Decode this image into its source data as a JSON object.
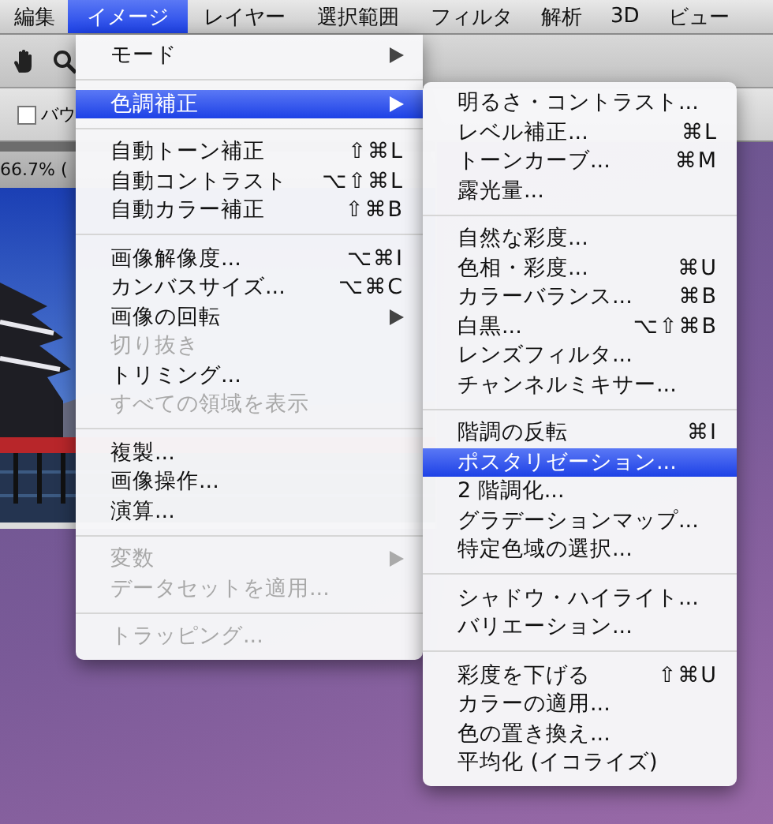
{
  "menu_bar": [
    {
      "label": "編集",
      "selected": false
    },
    {
      "label": "イメージ",
      "selected": true
    },
    {
      "label": "レイヤー",
      "selected": false
    },
    {
      "label": "選択範囲",
      "selected": false
    },
    {
      "label": "フィルタ",
      "selected": false
    },
    {
      "label": "解析",
      "selected": false
    },
    {
      "label": "3D",
      "selected": false
    },
    {
      "label": "ビュー",
      "selected": false
    }
  ],
  "options_bar": {
    "checkbox": {
      "label": "バウ",
      "checked": false
    }
  },
  "document": {
    "tab_title": "66.7% ("
  },
  "image_menu": {
    "items": [
      {
        "kind": "item",
        "label": "モード",
        "has_submenu": true,
        "disabled": false,
        "selected": false
      },
      {
        "kind": "separator"
      },
      {
        "kind": "item",
        "label": "色調補正",
        "has_submenu": true,
        "disabled": false,
        "selected": true
      },
      {
        "kind": "separator"
      },
      {
        "kind": "item",
        "label": "自動トーン補正",
        "shortcut": "⇧⌘L",
        "has_submenu": false,
        "disabled": false,
        "selected": false
      },
      {
        "kind": "item",
        "label": "自動コントラスト",
        "shortcut": "⌥⇧⌘L",
        "has_submenu": false,
        "disabled": false,
        "selected": false
      },
      {
        "kind": "item",
        "label": "自動カラー補正",
        "shortcut": "⇧⌘B",
        "has_submenu": false,
        "disabled": false,
        "selected": false
      },
      {
        "kind": "separator"
      },
      {
        "kind": "item",
        "label": "画像解像度...",
        "shortcut": "⌥⌘I",
        "has_submenu": false,
        "disabled": false,
        "selected": false
      },
      {
        "kind": "item",
        "label": "カンバスサイズ...",
        "shortcut": "⌥⌘C",
        "has_submenu": false,
        "disabled": false,
        "selected": false
      },
      {
        "kind": "item",
        "label": "画像の回転",
        "has_submenu": true,
        "disabled": false,
        "selected": false
      },
      {
        "kind": "item",
        "label": "切り抜き",
        "has_submenu": false,
        "disabled": true,
        "selected": false
      },
      {
        "kind": "item",
        "label": "トリミング...",
        "has_submenu": false,
        "disabled": false,
        "selected": false
      },
      {
        "kind": "item",
        "label": "すべての領域を表示",
        "has_submenu": false,
        "disabled": true,
        "selected": false
      },
      {
        "kind": "separator"
      },
      {
        "kind": "item",
        "label": "複製...",
        "has_submenu": false,
        "disabled": false,
        "selected": false
      },
      {
        "kind": "item",
        "label": "画像操作...",
        "has_submenu": false,
        "disabled": false,
        "selected": false
      },
      {
        "kind": "item",
        "label": "演算...",
        "has_submenu": false,
        "disabled": false,
        "selected": false
      },
      {
        "kind": "separator"
      },
      {
        "kind": "item",
        "label": "変数",
        "has_submenu": true,
        "disabled": true,
        "selected": false
      },
      {
        "kind": "item",
        "label": "データセットを適用...",
        "has_submenu": false,
        "disabled": true,
        "selected": false
      },
      {
        "kind": "separator"
      },
      {
        "kind": "item",
        "label": "トラッピング...",
        "has_submenu": false,
        "disabled": true,
        "selected": false
      }
    ]
  },
  "adjustments_menu": {
    "items": [
      {
        "kind": "item",
        "label": "明るさ・コントラスト...",
        "has_submenu": false,
        "disabled": false,
        "selected": false
      },
      {
        "kind": "item",
        "label": "レベル補正...",
        "shortcut": "⌘L",
        "has_submenu": false,
        "disabled": false,
        "selected": false
      },
      {
        "kind": "item",
        "label": "トーンカーブ...",
        "shortcut": "⌘M",
        "has_submenu": false,
        "disabled": false,
        "selected": false
      },
      {
        "kind": "item",
        "label": "露光量...",
        "has_submenu": false,
        "disabled": false,
        "selected": false
      },
      {
        "kind": "separator"
      },
      {
        "kind": "item",
        "label": "自然な彩度...",
        "has_submenu": false,
        "disabled": false,
        "selected": false
      },
      {
        "kind": "item",
        "label": "色相・彩度...",
        "shortcut": "⌘U",
        "has_submenu": false,
        "disabled": false,
        "selected": false
      },
      {
        "kind": "item",
        "label": "カラーバランス...",
        "shortcut": "⌘B",
        "has_submenu": false,
        "disabled": false,
        "selected": false
      },
      {
        "kind": "item",
        "label": "白黒...",
        "shortcut": "⌥⇧⌘B",
        "has_submenu": false,
        "disabled": false,
        "selected": false
      },
      {
        "kind": "item",
        "label": "レンズフィルタ...",
        "has_submenu": false,
        "disabled": false,
        "selected": false
      },
      {
        "kind": "item",
        "label": "チャンネルミキサー...",
        "has_submenu": false,
        "disabled": false,
        "selected": false
      },
      {
        "kind": "separator"
      },
      {
        "kind": "item",
        "label": "階調の反転",
        "shortcut": "⌘I",
        "has_submenu": false,
        "disabled": false,
        "selected": false
      },
      {
        "kind": "item",
        "label": "ポスタリゼーション...",
        "has_submenu": false,
        "disabled": false,
        "selected": true
      },
      {
        "kind": "item",
        "label": "2 階調化...",
        "has_submenu": false,
        "disabled": false,
        "selected": false
      },
      {
        "kind": "item",
        "label": "グラデーションマップ...",
        "has_submenu": false,
        "disabled": false,
        "selected": false
      },
      {
        "kind": "item",
        "label": "特定色域の選択...",
        "has_submenu": false,
        "disabled": false,
        "selected": false
      },
      {
        "kind": "separator"
      },
      {
        "kind": "item",
        "label": "シャドウ・ハイライト...",
        "has_submenu": false,
        "disabled": false,
        "selected": false
      },
      {
        "kind": "item",
        "label": "バリエーション...",
        "has_submenu": false,
        "disabled": false,
        "selected": false
      },
      {
        "kind": "separator"
      },
      {
        "kind": "item",
        "label": "彩度を下げる",
        "shortcut": "⇧⌘U",
        "has_submenu": false,
        "disabled": false,
        "selected": false
      },
      {
        "kind": "item",
        "label": "カラーの適用...",
        "has_submenu": false,
        "disabled": false,
        "selected": false
      },
      {
        "kind": "item",
        "label": "色の置き換え...",
        "has_submenu": false,
        "disabled": false,
        "selected": false
      },
      {
        "kind": "item",
        "label": "平均化 (イコライズ)",
        "has_submenu": false,
        "disabled": false,
        "selected": false
      }
    ]
  }
}
